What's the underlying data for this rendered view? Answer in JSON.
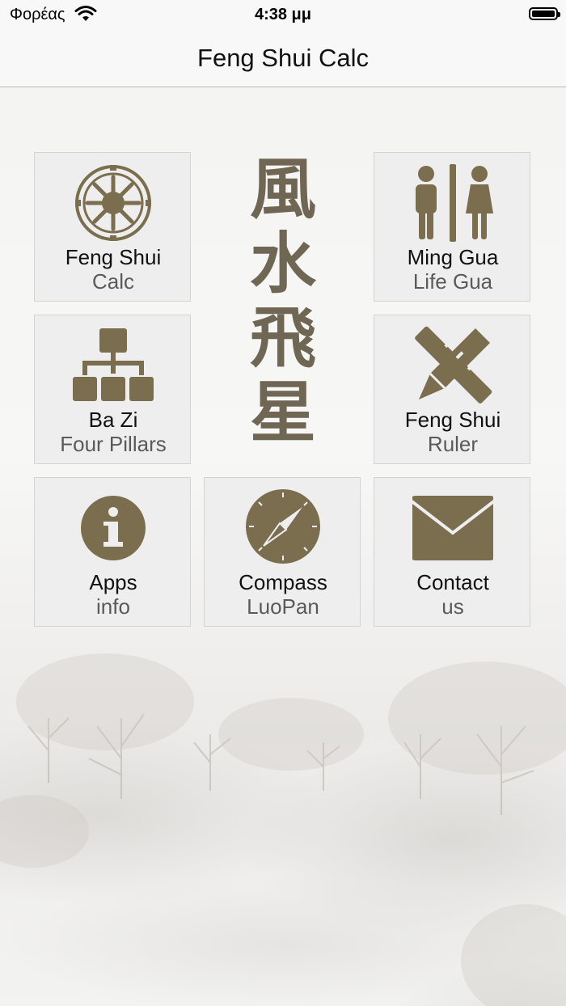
{
  "status_bar": {
    "carrier": "Φορέας",
    "time": "4:38 μμ"
  },
  "nav": {
    "title": "Feng Shui Calc"
  },
  "calligraphy": [
    "風",
    "水",
    "飛",
    "星"
  ],
  "theme": {
    "icon_color": "#7a6e4f",
    "tile_bg": "#eeeeee"
  },
  "tiles": [
    {
      "line1": "Feng Shui",
      "line2": "Calc",
      "icon": "dharma-wheel-icon"
    },
    {
      "line1": "Ming Gua",
      "line2": "Life Gua",
      "icon": "man-woman-icon"
    },
    {
      "line1": "Ba Zi",
      "line2": "Four Pillars",
      "icon": "org-chart-icon"
    },
    {
      "line1": "Feng Shui",
      "line2": "Ruler",
      "icon": "ruler-pencil-icon"
    },
    {
      "line1": "Apps",
      "line2": "info",
      "icon": "info-icon"
    },
    {
      "line1": "Compass",
      "line2": "LuoPan",
      "icon": "compass-icon"
    },
    {
      "line1": "Contact",
      "line2": "us",
      "icon": "envelope-icon"
    }
  ]
}
